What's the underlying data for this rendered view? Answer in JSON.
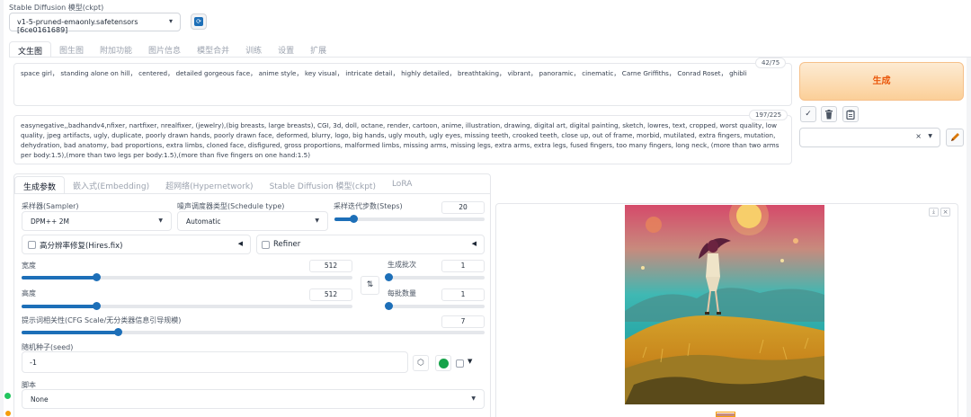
{
  "model": {
    "label": "Stable Diffusion 模型(ckpt)",
    "selected": "v1-5-pruned-emaonly.safetensors [6ce0161689]"
  },
  "main_tabs": [
    {
      "label": "文生图"
    },
    {
      "label": "图生图"
    },
    {
      "label": "附加功能"
    },
    {
      "label": "图片信息"
    },
    {
      "label": "模型合并"
    },
    {
      "label": "训练"
    },
    {
      "label": "设置"
    },
    {
      "label": "扩展"
    }
  ],
  "prompt": {
    "text": "space girl， standing alone on hill， centered， detailed gorgeous face， anime style， key visual， intricate detail， highly detailed， breathtaking， vibrant， panoramic， cinematic， Carne Griffiths， Conrad Roset， ghibli",
    "counter": "42/75"
  },
  "negative_prompt": {
    "text": "easynegative,,badhandv4,nfixer, nartfixer, nrealfixer, (jewelry),(big breasts, large breasts), CGI, 3d, doll, octane, render, cartoon, anime, illustration, drawing, digital art, digital painting, sketch, lowres, text, cropped, worst quality, low quality, jpeg artifacts, ugly, duplicate, poorly drawn hands, poorly drawn face, deformed, blurry, logo, big hands, ugly mouth, ugly eyes, missing teeth, crooked teeth, close up, out of frame, morbid, mutilated, extra fingers, mutation, dehydration, bad anatomy, bad proportions, extra limbs, cloned face, disfigured, gross proportions, malformed limbs, missing arms, missing legs, extra arms, extra legs, fused fingers, too many fingers, long neck, (more than two arms per body:1.5),(more than two legs per body:1.5),(more than five fingers on one hand:1.5)",
    "counter": "197/225"
  },
  "generate_label": "生成",
  "tool_icons": {
    "check": "✓",
    "swap": "⇅",
    "dice": "⬡"
  },
  "style_select": {
    "clear": "×"
  },
  "sub_tabs": [
    {
      "label": "生成参数"
    },
    {
      "label": "嵌入式(Embedding)"
    },
    {
      "label": "超网络(Hypernetwork)"
    },
    {
      "label": "Stable Diffusion 模型(ckpt)"
    },
    {
      "label": "LoRA"
    }
  ],
  "sampler": {
    "label": "采样器(Sampler)",
    "value": "DPM++ 2M"
  },
  "schedule": {
    "label": "噪声调度器类型(Schedule type)",
    "value": "Automatic"
  },
  "steps": {
    "label": "采样迭代步数(Steps)",
    "value": "20",
    "min": 1,
    "max": 150
  },
  "hires": {
    "label": "高分辨率修复(Hires.fix)",
    "checked": false
  },
  "refiner": {
    "label": "Refiner",
    "checked": false
  },
  "width": {
    "label": "宽度",
    "value": "512",
    "min": 64,
    "max": 2048
  },
  "height": {
    "label": "高度",
    "value": "512",
    "min": 64,
    "max": 2048
  },
  "batch_count": {
    "label": "生成批次",
    "value": "1",
    "min": 1,
    "max": 100
  },
  "batch_size": {
    "label": "每批数量",
    "value": "1",
    "min": 1,
    "max": 8
  },
  "cfg": {
    "label": "提示词相关性(CFG Scale/无分类器信息引导规模)",
    "value": "7",
    "min": 1,
    "max": 30
  },
  "seed": {
    "label": "随机种子(seed)",
    "value": "-1"
  },
  "script": {
    "label": "脚本",
    "value": "None"
  },
  "colors": {
    "accent": "#1d6fb8",
    "generate": "#ea580c",
    "status_ok": "#22c55e"
  }
}
